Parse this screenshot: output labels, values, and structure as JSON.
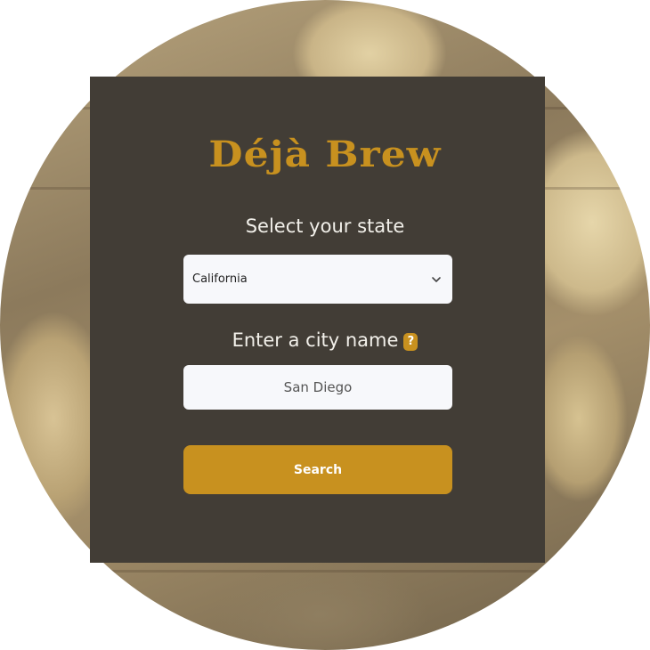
{
  "app": {
    "brand": "Déjà Brew"
  },
  "form": {
    "state_label": "Select your state",
    "state_selected": "California",
    "city_label": "Enter a city name",
    "city_help": "?",
    "city_value": "San Diego",
    "search_label": "Search"
  },
  "colors": {
    "accent": "#c8911f",
    "panel": "#423d36",
    "field_bg": "#f7f8fb",
    "label_text": "#f2f0ea"
  },
  "icons": {
    "select_arrow": "chevron-down-icon",
    "help": "question-icon"
  }
}
